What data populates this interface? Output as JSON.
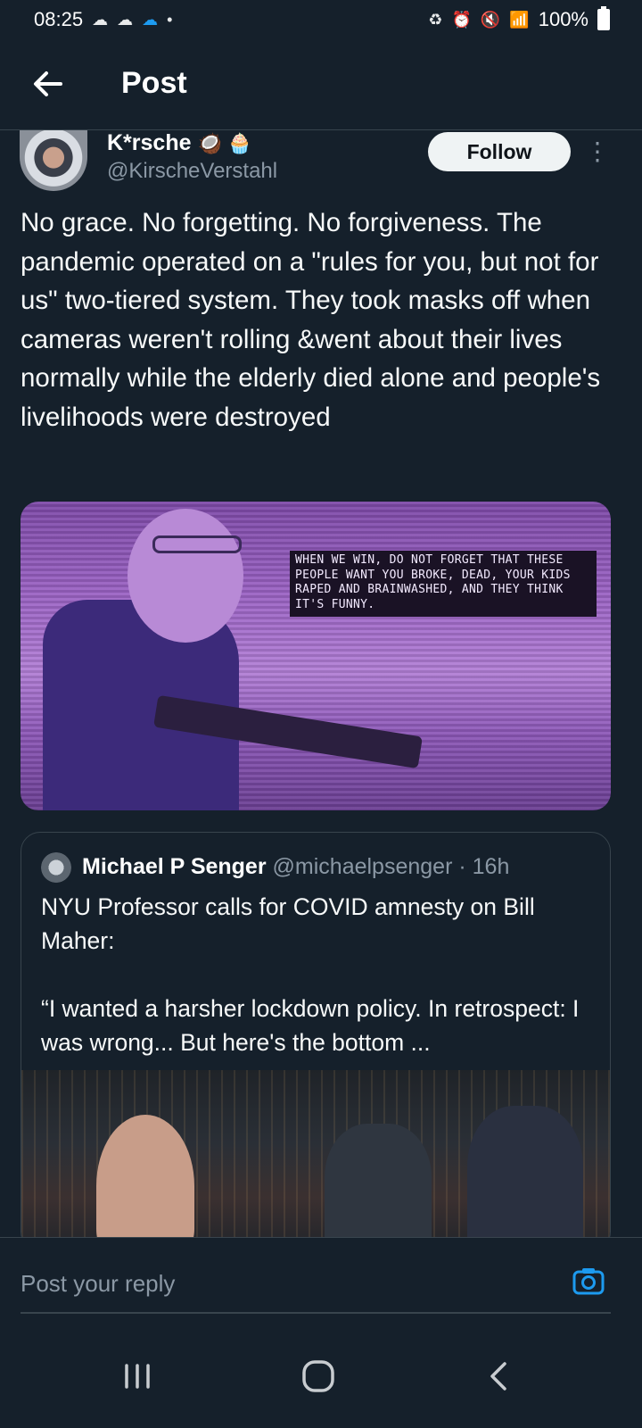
{
  "status_bar": {
    "time": "08:25",
    "battery": "100%"
  },
  "header": {
    "title": "Post"
  },
  "post": {
    "author_name": "K*rsche",
    "author_emojis": "🥥 🧁",
    "author_handle": "@KirscheVerstahl",
    "follow_label": "Follow",
    "text": "No grace. No forgetting. No forgiveness. The pandemic operated on a \"rules for you, but not for us\" two-tiered system. They took masks off when cameras weren't rolling &went about their lives normally while the elderly died alone and people's livelihoods were destroyed",
    "media_caption": "WHEN WE WIN, DO NOT FORGET THAT THESE PEOPLE WANT YOU BROKE, DEAD, YOUR KIDS RAPED AND BRAINWASHED, AND THEY THINK IT'S FUNNY."
  },
  "quoted": {
    "name": "Michael P Senger",
    "handle": "@michaelpsenger",
    "time": "· 16h",
    "text_line1": "NYU Professor calls for COVID amnesty on Bill Maher:",
    "text_line2": "“I wanted a harsher lockdown policy. In retrospect: I was wrong... But here's the bottom ..."
  },
  "reply": {
    "placeholder": "Post your reply"
  },
  "colors": {
    "background": "#15202b",
    "accent": "#1d9bf0",
    "muted": "#8b98a5",
    "border": "#38444d"
  }
}
